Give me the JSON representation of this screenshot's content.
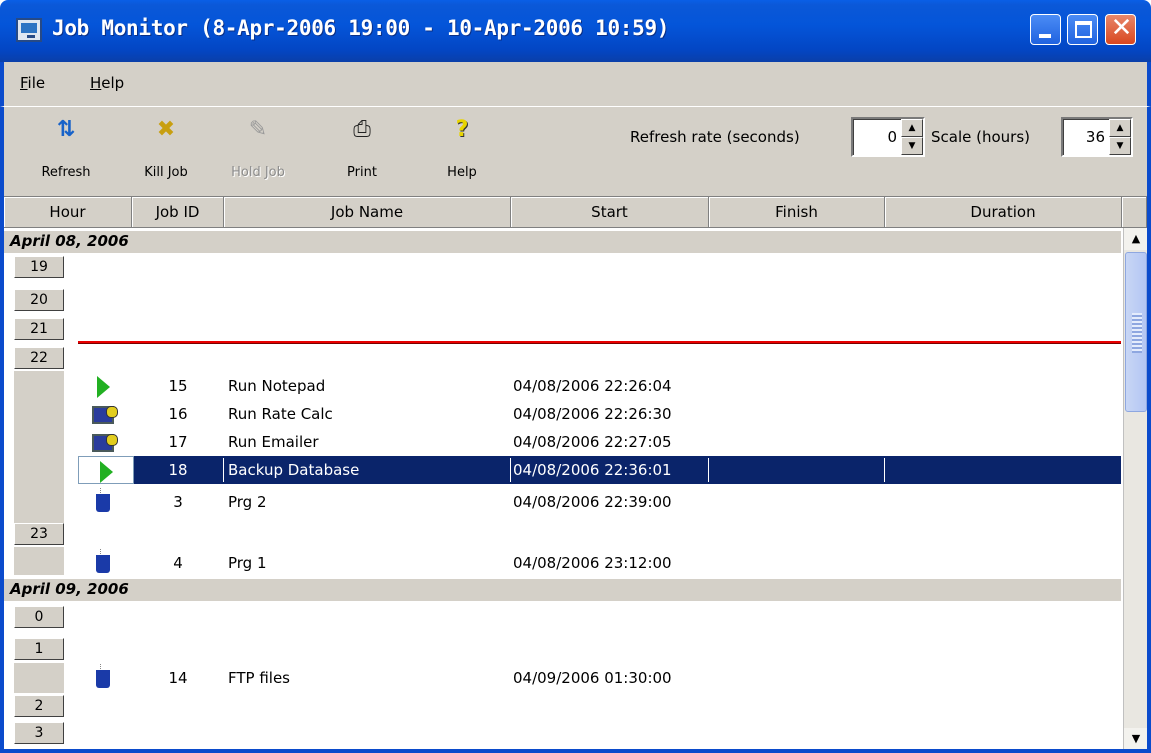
{
  "window": {
    "title": "Job Monitor (8-Apr-2006 19:00 - 10-Apr-2006 10:59)",
    "minimize": "minimize",
    "maximize": "maximize",
    "close": "✕"
  },
  "menu": {
    "file": {
      "accel": "F",
      "rest": "ile"
    },
    "help": {
      "accel": "H",
      "rest": "elp"
    }
  },
  "toolbar": {
    "refresh": {
      "label": "Refresh",
      "icon": "refresh-arrows-icon",
      "glyph": "⇅"
    },
    "kill": {
      "label": "Kill Job",
      "icon": "kill-job-icon",
      "glyph": "✖"
    },
    "hold": {
      "label": "Hold Job",
      "icon": "pin-icon",
      "glyph": "✎",
      "enabled": false
    },
    "print": {
      "label": "Print",
      "icon": "printer-icon",
      "glyph": "⎙"
    },
    "help": {
      "label": "Help",
      "icon": "question-icon",
      "glyph": "?"
    },
    "refresh_rate_label": "Refresh rate (seconds)",
    "refresh_rate_value": "0",
    "scale_label": "Scale (hours)",
    "scale_value": "36"
  },
  "columns": [
    "Hour",
    "Job ID",
    "Job Name",
    "Start",
    "Finish",
    "Duration"
  ],
  "dates": [
    "April 08, 2006",
    "April 09, 2006"
  ],
  "hours": [
    "19",
    "20",
    "21",
    "22",
    "23",
    "0",
    "1",
    "2",
    "3"
  ],
  "jobs": [
    {
      "icon": "play-icon",
      "id": "15",
      "name": "Run Notepad",
      "start": "04/08/2006 22:26:04",
      "finish": "",
      "duration": ""
    },
    {
      "icon": "computer-job-icon",
      "id": "16",
      "name": "Run Rate Calc",
      "start": "04/08/2006 22:26:30",
      "finish": "",
      "duration": ""
    },
    {
      "icon": "computer-job-icon",
      "id": "17",
      "name": "Run Emailer",
      "start": "04/08/2006 22:27:05",
      "finish": "",
      "duration": ""
    },
    {
      "icon": "play-icon",
      "id": "18",
      "name": "Backup Database",
      "start": "04/08/2006 22:36:01",
      "finish": "",
      "duration": "",
      "selected": true
    },
    {
      "icon": "coffee-icon",
      "id": "3",
      "name": "Prg 2",
      "start": "04/08/2006 22:39:00",
      "finish": "",
      "duration": ""
    },
    {
      "icon": "coffee-icon",
      "id": "4",
      "name": "Prg 1",
      "start": "04/08/2006 23:12:00",
      "finish": "",
      "duration": ""
    },
    {
      "icon": "coffee-icon",
      "id": "14",
      "name": "FTP files",
      "start": "04/09/2006 01:30:00",
      "finish": "",
      "duration": ""
    }
  ],
  "colors": {
    "title_bar": "#0455d9",
    "selection": "#0a246a",
    "now_line": "#e80000",
    "chrome": "#d4d0c8"
  }
}
